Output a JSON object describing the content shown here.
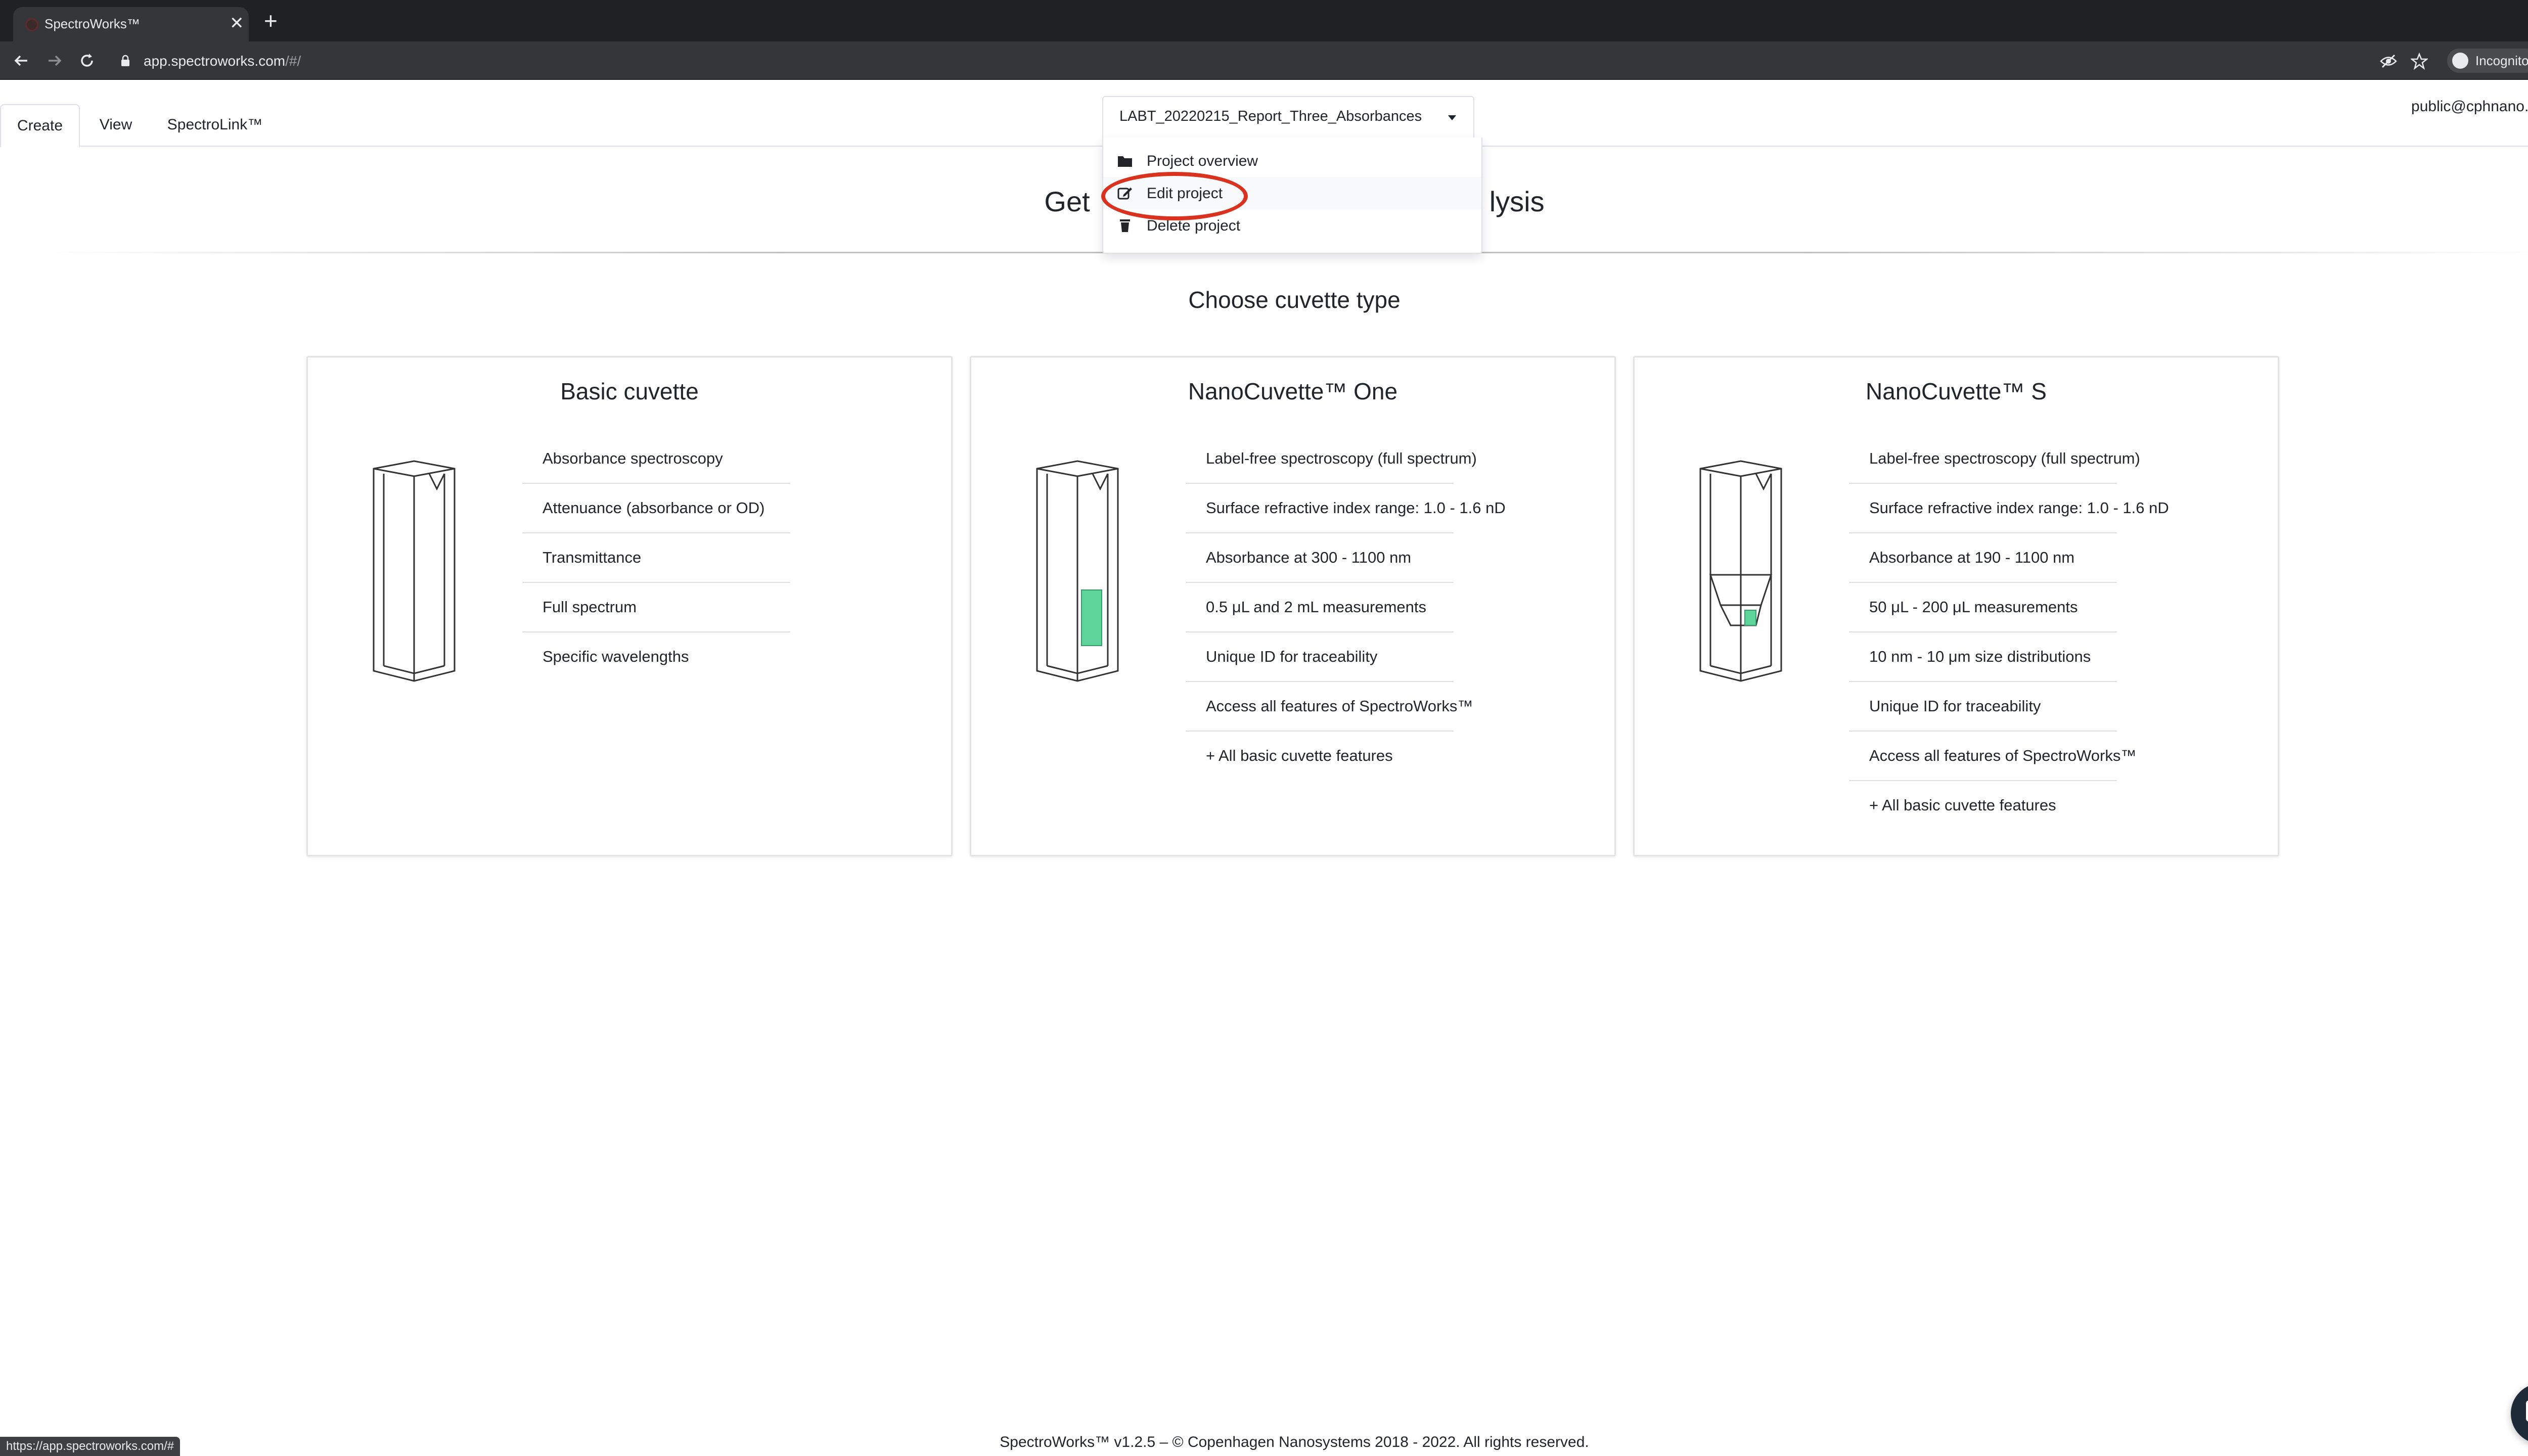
{
  "browser": {
    "tab_title": "SpectroWorks™",
    "tab_close": "✕",
    "new_tab": "+",
    "url_host": "app.spectroworks.com",
    "url_path": "/#/",
    "incognito_label": "Incognito"
  },
  "app_nav": {
    "tabs": [
      {
        "label": "Create",
        "active": true
      },
      {
        "label": "View",
        "active": false
      },
      {
        "label": "SpectroLink™",
        "active": false
      }
    ],
    "project_name": "LABT_20220215_Report_Three_Absorbances",
    "user_email": "public@cphnano.com"
  },
  "project_menu": {
    "items": [
      {
        "label": "Project overview",
        "icon": "folder-icon"
      },
      {
        "label": "Edit project",
        "icon": "edit-icon",
        "highlighted": true
      },
      {
        "label": "Delete project",
        "icon": "trash-icon"
      }
    ]
  },
  "header": {
    "headline_left": "Get",
    "headline_right": "lysis"
  },
  "section": {
    "title": "Choose cuvette type"
  },
  "cards": [
    {
      "title": "Basic cuvette",
      "features": [
        "Absorbance spectroscopy",
        "Attenuance (absorbance or OD)",
        "Transmittance",
        "Full spectrum",
        "Specific wavelengths"
      ]
    },
    {
      "title": "NanoCuvette™ One",
      "features": [
        "Label-free spectroscopy (full spectrum)",
        "Surface refractive index range: 1.0 - 1.6 nD",
        "Absorbance at 300 - 1100 nm",
        "0.5 μL and 2 mL measurements",
        "Unique ID for traceability",
        "Access all features of SpectroWorks™",
        "+ All basic cuvette features"
      ]
    },
    {
      "title": "NanoCuvette™ S",
      "features": [
        "Label-free spectroscopy (full spectrum)",
        "Surface refractive index range: 1.0 - 1.6 nD",
        "Absorbance at 190 - 1100 nm",
        "50 μL - 200 μL measurements",
        "10 nm - 10 μm size distributions",
        "Unique ID for traceability",
        "Access all features of SpectroWorks™",
        "+ All basic cuvette features"
      ]
    }
  ],
  "footer": {
    "text": "SpectroWorks™ v1.2.5 – © Copenhagen Nanosystems 2018 - 2022. All rights reserved."
  },
  "status_bar": {
    "url": "https://app.spectroworks.com/#"
  },
  "colors": {
    "annotation_ring": "#d9321f",
    "sensor_green": "#5fd49a",
    "chat_button": "#1f2a38"
  }
}
